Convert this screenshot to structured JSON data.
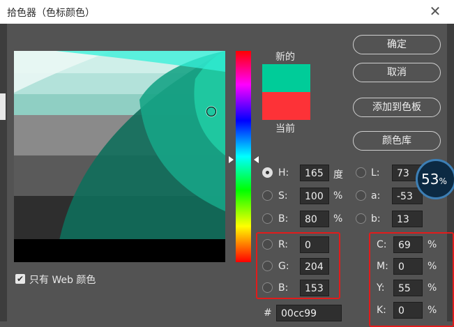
{
  "window": {
    "title": "拾色器（色标颜色）",
    "close_glyph": "✕"
  },
  "swatch": {
    "new_label": "新的",
    "current_label": "当前",
    "new_color": "#00cc99",
    "current_color": "#fd3237"
  },
  "buttons": {
    "ok": "确定",
    "cancel": "取消",
    "add_to_swatches": "添加到色板",
    "color_libraries": "颜色库"
  },
  "hsb": {
    "h": {
      "label": "H:",
      "value": "165",
      "unit": "度",
      "selected": true
    },
    "s": {
      "label": "S:",
      "value": "100",
      "unit": "%"
    },
    "b": {
      "label": "B:",
      "value": "80",
      "unit": "%"
    }
  },
  "lab": {
    "l": {
      "label": "L:",
      "value": "73"
    },
    "a": {
      "label": "a:",
      "value": "-53"
    },
    "b": {
      "label": "b:",
      "value": "13"
    }
  },
  "rgb": {
    "r": {
      "label": "R:",
      "value": "0"
    },
    "g": {
      "label": "G:",
      "value": "204"
    },
    "b": {
      "label": "B:",
      "value": "153"
    }
  },
  "cmyk": {
    "c": {
      "label": "C:",
      "value": "69",
      "unit": "%"
    },
    "m": {
      "label": "M:",
      "value": "0",
      "unit": "%"
    },
    "y": {
      "label": "Y:",
      "value": "55",
      "unit": "%"
    },
    "k": {
      "label": "K:",
      "value": "0",
      "unit": "%"
    }
  },
  "hex": {
    "label": "#",
    "value": "00cc99"
  },
  "web_only": {
    "label": "只有 Web 颜色",
    "checked": true,
    "check_glyph": "✔"
  },
  "overlay_badge": {
    "value": "53",
    "unit": "%"
  },
  "colors": {
    "highlight_box": "#e21b1b",
    "dialog_bg": "#535353"
  }
}
